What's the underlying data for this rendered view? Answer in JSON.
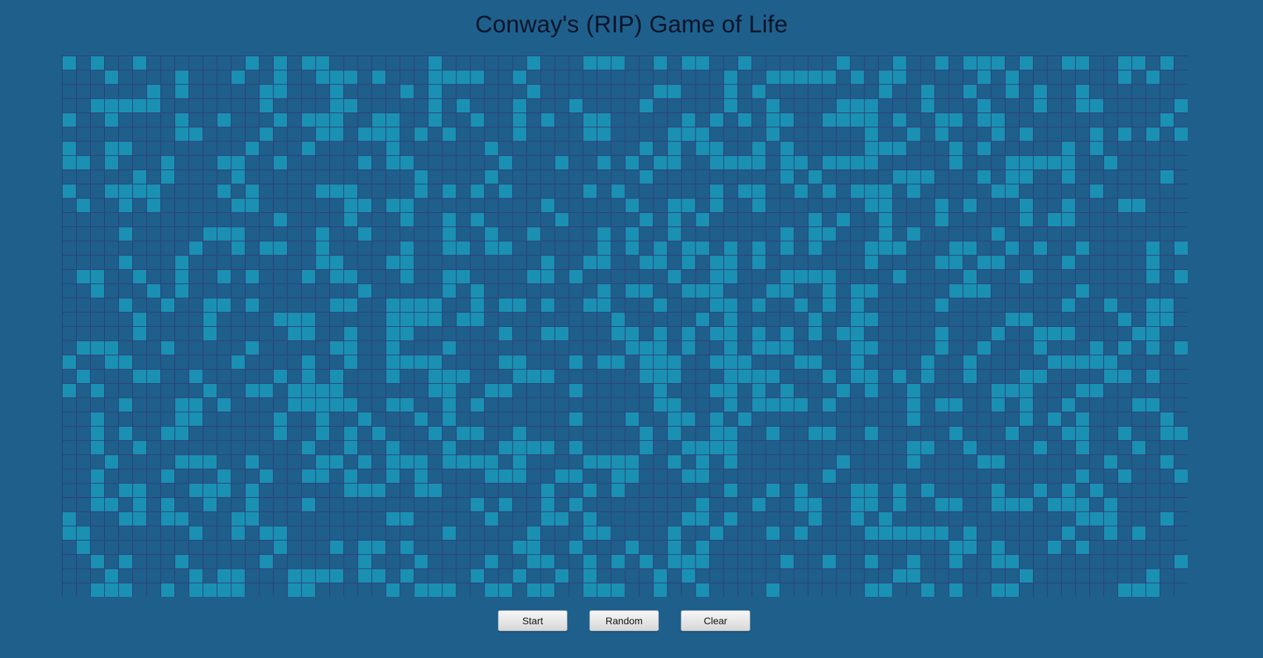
{
  "app": {
    "title": "Conway's (RIP) Game of Life"
  },
  "buttons": {
    "start": "Start",
    "random": "Random",
    "clear": "Clear"
  },
  "board": {
    "columns": 80,
    "rows": 38,
    "alive_color": "#1a91b3",
    "dead_color": "#1f5f8b",
    "grid_color": "#2d407b",
    "random_fill_ratio": 0.3,
    "seed": 20240607
  }
}
